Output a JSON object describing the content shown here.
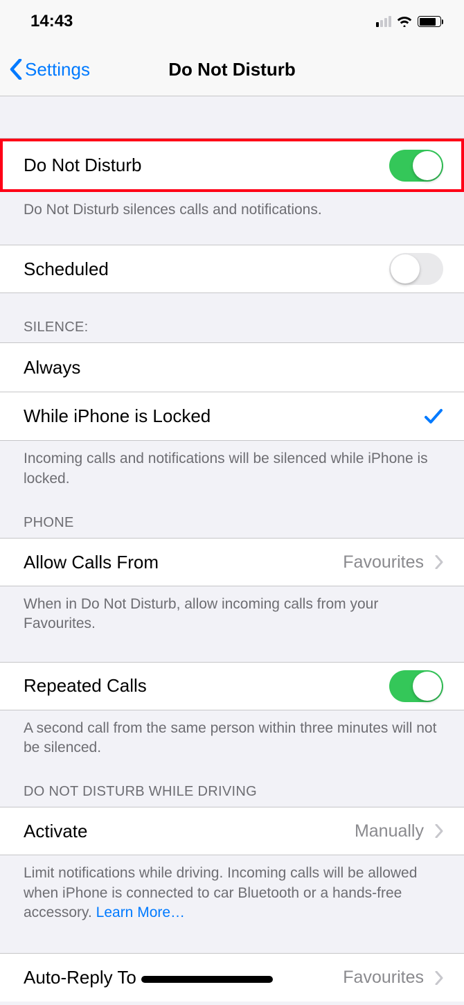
{
  "status_bar": {
    "time": "14:43"
  },
  "nav": {
    "back_label": "Settings",
    "title": "Do Not Disturb"
  },
  "main_toggle": {
    "label": "Do Not Disturb",
    "on": true
  },
  "main_footer": "Do Not Disturb silences calls and notifications.",
  "scheduled": {
    "label": "Scheduled",
    "on": false
  },
  "silence": {
    "header": "SILENCE:",
    "options": [
      {
        "label": "Always",
        "selected": false
      },
      {
        "label": "While iPhone is Locked",
        "selected": true
      }
    ],
    "footer": "Incoming calls and notifications will be silenced while iPhone is locked."
  },
  "phone": {
    "header": "PHONE",
    "allow_calls": {
      "label": "Allow Calls From",
      "value": "Favourites"
    },
    "allow_calls_footer": "When in Do Not Disturb, allow incoming calls from your Favourites.",
    "repeated_calls": {
      "label": "Repeated Calls",
      "on": true
    },
    "repeated_calls_footer": "A second call from the same person within three minutes will not be silenced."
  },
  "driving": {
    "header": "DO NOT DISTURB WHILE DRIVING",
    "activate": {
      "label": "Activate",
      "value": "Manually"
    },
    "footer_text": "Limit notifications while driving. Incoming calls will be allowed when iPhone is connected to car Bluetooth or a hands-free accessory. ",
    "learn_more": "Learn More…",
    "auto_reply": {
      "label": "Auto-Reply To",
      "value": "Favourites"
    }
  }
}
